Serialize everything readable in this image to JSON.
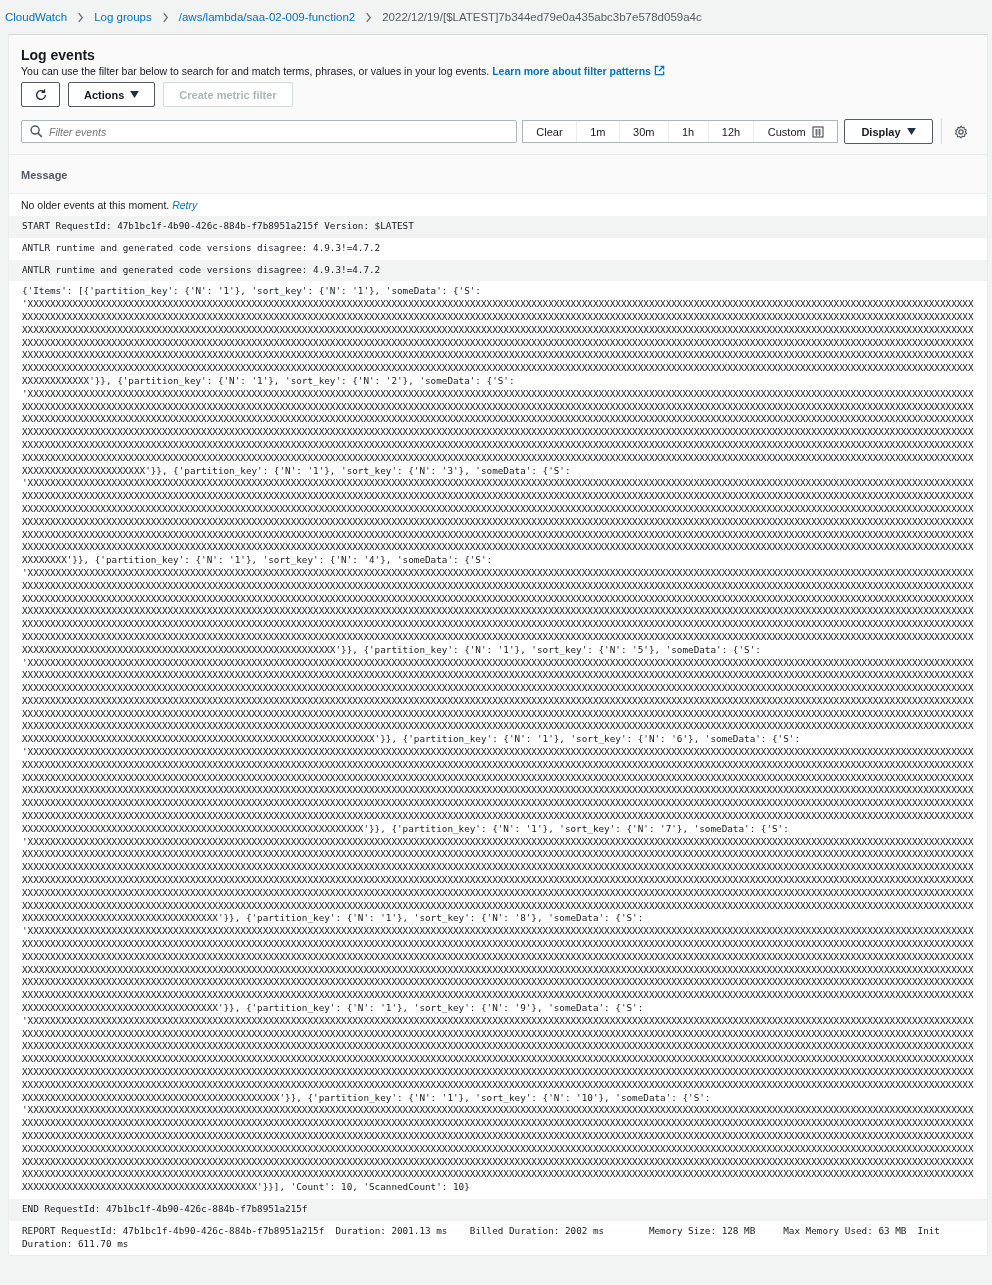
{
  "breadcrumbs": [
    {
      "label": "CloudWatch",
      "link": true
    },
    {
      "label": "Log groups",
      "link": true
    },
    {
      "label": "/aws/lambda/saa-02-009-function2",
      "link": true
    },
    {
      "label": "2022/12/19/[$LATEST]7b344ed79e0a435abc3b7e578d059a4c",
      "link": false
    }
  ],
  "panel": {
    "title": "Log events",
    "description": "You can use the filter bar below to search for and match terms, phrases, or values in your log events.",
    "learn_more": "Learn more about filter patterns"
  },
  "toolbar": {
    "actions": "Actions",
    "create_metric_filter": {
      "label": "Create metric filter",
      "disabled": true
    }
  },
  "filter": {
    "placeholder": "Filter events"
  },
  "time_ranges": [
    {
      "label": "Clear",
      "selected": false
    },
    {
      "label": "1m",
      "selected": false
    },
    {
      "label": "30m",
      "selected": false
    },
    {
      "label": "1h",
      "selected": false
    },
    {
      "label": "12h",
      "selected": false
    },
    {
      "label": "Custom",
      "selected": false
    }
  ],
  "display": "Display",
  "table": {
    "columns": [
      "Message"
    ],
    "rows": [
      {
        "kind": "notice",
        "text": "No older events at this moment.",
        "link": "Retry"
      },
      {
        "kind": "event",
        "text": "START RequestId: 47b1bc1f-4b90-426c-884b-f7b8951a215f Version: $LATEST"
      },
      {
        "kind": "event",
        "text": "ANTLR runtime and generated code versions disagree: 4.9.3!=4.7.2"
      },
      {
        "kind": "event",
        "text": "ANTLR runtime and generated code versions disagree: 4.9.3!=4.7.2"
      },
      {
        "kind": "event",
        "text": "{'Items': [{'partition_key': {'N': '1'}, 'sort_key': {'N': '1'}, 'someData': {'S': 'XXXXXXXXXXXXXXXXXXXXXXXXXXXXXXXXXXXXXXXXXXXXXXXXXXXXXXXXXXXXXXXXXXXXXXXXXXXXXXXXXXXXXXXXXXXXXXXXXXXXXXXXXXXXXXXXXXXXXXXXXXXXXXXXXXXXXXXXXXXXXXXXXXXXXXXXXXXXXXXXXXXXXXXXXXXXXXXXXXXXXXXXXXXXXXXXXXXXXXXXXXXXXXXXXXXXXXXXXXXXXXXXXXXXXXXXXXXXXXXXXXXXXXXXXXXXXXXXXXXXXXXXXXXXXXXXXXXXXXXXXXXXXXXXXXXXXXXXXXXXXXXXXXXXXXXXXXXXXXXXXXXXXXXXXXXXXXXXXXXXXXXXXXXXXXXXXXXXXXXXXXXXXXXXXXXXXXXXXXXXXXXXXXXXXXXXXXXXXXXXXXXXXXXXXXXXXXXXXXXXXXXXXXXXXXXXXXXXXXXXXXXXXXXXXXXXXXXXXXXXXXXXXXXXXXXXXXXXXXXXXXXXXXXXXXXXXXXXXXXXXXXXXXXXXXXXXXXXXXXXXXXXXXXXXXXXXXXXXXXXXXXXXXXXXXXXXXXXXXXXXXXXXXXXXXXXXXXXXXXXXXXXXXXXXXXXXXXXXXXXXXXXXXXXXXXXXXXXXXXXXXXXXXXXXXXXXXXXXXXXXXXXXXXXXXXXXXXXXXXXXXXXXXXXXXXXXXXXXXXXXXXXXXXXXXXXXXXXXXXXXXXXXXXXXXXXXXXXXXXXXXXXXXXXXXXXXXXXXXXXXXXXXXXXXXXXXXXXXXXXXXXXXXXXXXXXXXXXXXXXXXXXXXXXXXXXXXXXXXXXXXXXXXXXXXXXXXXXXXXXXXXXXXXXXXXXXXXXXXXXXXXXXXXXXXXXXXXXXXXXXXXXXXXXXXXXXXXXXXXXXXXXXXXXXXXXXXXXXXXXXXXXXXXXXXXXXXXXXXXXXXXXXXXXXXXXXXXXXXXXXXXXXXXXXXXXXXXXXXXXXXXXXXXXXXXXXXXXXXXXXXXXXXXXXXXXXXXXXXXXXXXXXXXXXXXXXXXXXXXXXXXXXXXXXXX'}}, {'partition_key': {'N': '1'}, 'sort_key': {'N': '2'}, 'someData': {'S': 'XXXXXXXXXXXXXXXXXXXXXXXXXXXXXXXXXXXXXXXXXXXXXXXXXXXXXXXXXXXXXXXXXXXXXXXXXXXXXXXXXXXXXXXXXXXXXXXXXXXXXXXXXXXXXXXXXXXXXXXXXXXXXXXXXXXXXXXXXXXXXXXXXXXXXXXXXXXXXXXXXXXXXXXXXXXXXXXXXXXXXXXXXXXXXXXXXXXXXXXXXXXXXXXXXXXXXXXXXXXXXXXXXXXXXXXXXXXXXXXXXXXXXXXXXXXXXXXXXXXXXXXXXXXXXXXXXXXXXXXXXXXXXXXXXXXXXXXXXXXXXXXXXXXXXXXXXXXXXXXXXXXXXXXXXXXXXXXXXXXXXXXXXXXXXXXXXXXXXXXXXXXXXXXXXXXXXXXXXXXXXXXXXXXXXXXXXXXXXXXXXXXXXXXXXXXXXXXXXXXXXXXXXXXXXXXXXXXXXXXXXXXXXXXXXXXXXXXXXXXXXXXXXXXXXXXXXXXXXXXXXXXXXXXXXXXXXXXXXXXXXXXXXXXXXXXXXXXXXXXXXXXXXXXXXXXXXXXXXXXXXXXXXXXXXXXXXXXXXXXXXXXXXXXXXXXXXXXXXXXXXXXXXXXXXXXXXXXXXXXXXXXXXXXXXXXXXXXXXXXXXXXXXXXXXXXXXXXXXXXXXXXXXXXXXXXXXXXXXXXXXXXXXXXXXXXXXXXXXXXXXXXXXXXXXXXXXXXXXXXXXXXXXXXXXXXXXXXXXXXXXXXXXXXXXXXXXXXXXXXXXXXXXXXXXXXXXXXXXXXXXXXXXXXXXXXXXXXXXXXXXXXXXXXXXXXXXXXXXXXXXXXXXXXXXXXXXXXXXXXXXXXXXXXXXXXXXXXXXXXXXXXXXXXXXXXXXXXXXXXXXXXXXXXXXXXXXXXXXXXXXXXXXXXXXXXXXXXXXXXXXXXXXXXXXXXXXXXXXXXXXXXXXXXXXXXXXXXXXXXXXXXXXXXXXXXXXXXXXXXXXXXXXXXXXXXXXXXXXXXXXXXXXXXXXXXXXXXXXXXXXXXXXXXXXXXXXXXXXXXXXXXXXXXXXXXXXXXXXXXXX'}}, {'partition_key': {'N': '1'}, 'sort_key': {'N': '3'}, 'someData': {'S': 'XXXXXXXXXXXXXXXXXXXXXXXXXXXXXXXXXXXXXXXXXXXXXXXXXXXXXXXXXXXXXXXXXXXXXXXXXXXXXXXXXXXXXXXXXXXXXXXXXXXXXXXXXXXXXXXXXXXXXXXXXXXXXXXXXXXXXXXXXXXXXXXXXXXXXXXXXXXXXXXXXXXXXXXXXXXXXXXXXXXXXXXXXXXXXXXXXXXXXXXXXXXXXXXXXXXXXXXXXXXXXXXXXXXXXXXXXXXXXXXXXXXXXXXXXXXXXXXXXXXXXXXXXXXXXXXXXXXXXXXXXXXXXXXXXXXXXXXXXXXXXXXXXXXXXXXXXXXXXXXXXXXXXXXXXXXXXXXXXXXXXXXXXXXXXXXXXXXXXXXXXXXXXXXXXXXXXXXXXXXXXXXXXXXXXXXXXXXXXXXXXXXXXXXXXXXXXXXXXXXXXXXXXXXXXXXXXXXXXXXXXXXXXXXXXXXXXXXXXXXXXXXXXXXXXXXXXXXXXXXXXXXXXXXXXXXXXXXXXXXXXXXXXXXXXXXXXXXXXXXXXXXXXXXXXXXXXXXXXXXXXXXXXXXXXXXXXXXXXXXXXXXXXXXXXXXXXXXXXXXXXXXXXXXXXXXXXXXXXXXXXXXXXXXXXXXXXXXXXXXXXXXXXXXXXXXXXXXXXXXXXXXXXXXXXXXXXXXXXXXXXXXXXXXXXXXXXXXXXXXXXXXXXXXXXXXXXXXXXXXXXXXXXXXXXXXXXXXXXXXXXXXXXXXXXXXXXXXXXXXXXXXXXXXXXXXXXXXXXXXXXXXXXXXXXXXXXXXXXXXXXXXXXXXXXXXXXXXXXXXXXXXXXXXXXXXXXXXXXXXXXXXXXXXXXXXXXXXXXXXXXXXXXXXXXXXXXXXXXXXXXXXXXXXXXXXXXXXXXXXXXXXXXXXXXXXXXXXXXXXXXXXXXXXXXXXXXXXXXXXXXXXXXXXXXXXXXXXXXXXXXXXXXXXXXXXXXXXXXXXXXXXXXXXXXXXXXXXXXXXXXXXXXXXXXXXXXXXXXXXXXXXXXXXXXXXXXXXXXXXXXXXXXXX'}}, {'partition_key': {'N': '1'}, 'sort_key': {'N': '4'}, 'someData': {'S': 'XXXXXXXXXXXXXXXXXXXXXXXXXXXXXXXXXXXXXXXXXXXXXXXXXXXXXXXXXXXXXXXXXXXXXXXXXXXXXXXXXXXXXXXXXXXXXXXXXXXXXXXXXXXXXXXXXXXXXXXXXXXXXXXXXXXXXXXXXXXXXXXXXXXXXXXXXXXXXXXXXXXXXXXXXXXXXXXXXXXXXXXXXXXXXXXXXXXXXXXXXXXXXXXXXXXXXXXXXXXXXXXXXXXXXXXXXXXXXXXXXXXXXXXXXXXXXXXXXXXXXXXXXXXXXXXXXXXXXXXXXXXXXXXXXXXXXXXXXXXXXXXXXXXXXXXXXXXXXXXXXXXXXXXXXXXXXXXXXXXXXXXXXXXXXXXXXXXXXXXXXXXXXXXXXXXXXXXXXXXXXXXXXXXXXXXXXXXXXXXXXXXXXXXXXXXXXXXXXXXXXXXXXXXXXXXXXXXXXXXXXXXXXXXXXXXXXXXXXXXXXXXXXXXXXXXXXXXXXXXXXXXXXXXXXXXXXXXXXXXXXXXXXXXXXXXXXXXXXXXXXXXXXXXXXXXXXXXXXXXXXXXXXXXXXXXXXXXXXXXXXXXXXXXXXXXXXXXXXXXXXXXXXXXXXXXXXXXXXXXXXXXXXXXXXXXXXXXXXXXXXXXXXXXXXXXXXXXXXXXXXXXXXXXXXXXXXXXXXXXXXXXXXXXXXXXXXXXXXXXXXXXXXXXXXXXXXXXXXXXXXXXXXXXXXXXXXXXXXXXXXXXXXXXXXXXXXXXXXXXXXXXXXXXXXXXXXXXXXXXXXXXXXXXXXXXXXXXXXXXXXXXXXXXXXXXXXXXXXXXXXXXXXXXXXXXXXXXXXXXXXXXXXXXXXXXXXXXXXXXXXXXXXXXXXXXXXXXXXXXXXXXXXXXXXXXXXXXXXXXXXXXXXXXXXXXXXXXXXXXXXXXXXXXXXXXXXXXXXXXXXXXXXXXXXXXXXXXXXXXXXXXXXXXXXXXXXXXXXXXXXXXXXXXXXXXXXXXXXXXXXXXXXXXXXXXXXXXXXXXXXXXXXXXXXXXXXXXXXXXXXXXXXXXXXXXXXXXXXXXXXXXXXXXXXXXXXXXXXXXXXXXXXXXXXXXXXXX'}}, {'partition_key': {'N': '1'}, 'sort_key': {'N': '5'}, 'someData': {'S': 'XXXXXXXXXXXXXXXXXXXXXXXXXXXXXXXXXXXXXXXXXXXXXXXXXXXXXXXXXXXXXXXXXXXXXXXXXXXXXXXXXXXXXXXXXXXXXXXXXXXXXXXXXXXXXXXXXXXXXXXXXXXXXXXXXXXXXXXXXXXXXXXXXXXXXXXXXXXXXXXXXXXXXXXXXXXXXXXXXXXXXXXXXXXXXXXXXXXXXXXXXXXXXXXXXXXXXXXXXXXXXXXXXXXXXXXXXXXXXXXXXXXXXXXXXXXXXXXXXXXXXXXXXXXXXXXXXXXXXXXXXXXXXXXXXXXXXXXXXXXXXXXXXXXXXXXXXXXXXXXXXXXXXXXXXXXXXXXXXXXXXXXXXXXXXXXXXXXXXXXXXXXXXXXXXXXXXXXXXXXXXXXXXXXXXXXXXXXXXXXXXXXXXXXXXXXXXXXXXXXXXXXXXXXXXXXXXXXXXXXXXXXXXXXXXXXXXXXXXXXXXXXXXXXXXXXXXXXXXXXXXXXXXXXXXXXXXXXXXXXXXXXXXXXXXXXXXXXXXXXXXXXXXXXXXXXXXXXXXXXXXXXXXXXXXXXXXXXXXXXXXXXXXXXXXXXXXXXXXXXXXXXXXXXXXXXXXXXXXXXXXXXXXXXXXXXXXXXXXXXXXXXXXXXXXXXXXXXXXXXXXXXXXXXXXXXXXXXXXXXXXXXXXXXXXXXXXXXXXXXXXXXXXXXXXXXXXXXXXXXXXXXXXXXXXXXXXXXXXXXXXXXXXXXXXXXXXXXXXXXXXXXXXXXXXXXXXXXXXXXXXXXXXXXXXXXXXXXXXXXXXXXXXXXXXXXXXXXXXXXXXXXXXXXXXXXXXXXXXXXXXXXXXXXXXXXXXXXXXXXXXXXXXXXXXXXXXXXXXXXXXXXXXXXXXXXXXXXXXXXXXXXXXXXXXXXXXXXXXXXXXXXXXXXXXXXXXXXXXXXXXXXXXXXXXXXXXXXXXXXXXXXXXXXXXXXXXXXXXXXXXXXXXXXXXXXXXXXXXXXXXXXXXXXXXXXXXXXXXXXXXXXXXXXXXXXXXXXXXXXXXXXXXXXXXXXXXXXXXXXXXXXXXXXXXXXXXXXXXXXXXXXXXXXXXXXXXXXXXXXXXX'}}, {'partition_key': {'N': '1'}, 'sort_key': {'N': '6'}, 'someData': {'S': 'XXXXXXXXXXXXXXXXXXXXXXXXXXXXXXXXXXXXXXXXXXXXXXXXXXXXXXXXXXXXXXXXXXXXXXXXXXXXXXXXXXXXXXXXXXXXXXXXXXXXXXXXXXXXXXXXXXXXXXXXXXXXXXXXXXXXXXXXXXXXXXXXXXXXXXXXXXXXXXXXXXXXXXXXXXXXXXXXXXXXXXXXXXXXXXXXXXXXXXXXXXXXXXXXXXXXXXXXXXXXXXXXXXXXXXXXXXXXXXXXXXXXXXXXXXXXXXXXXXXXXXXXXXXXXXXXXXXXXXXXXXXXXXXXXXXXXXXXXXXXXXXXXXXXXXXXXXXXXXXXXXXXXXXXXXXXXXXXXXXXXXXXXXXXXXXXXXXXXXXXXXXXXXXXXXXXXXXXXXXXXXXXXXXXXXXXXXXXXXXXXXXXXXXXXXXXXXXXXXXXXXXXXXXXXXXXXXXXXXXXXXXXXXXXXXXXXXXXXXXXXXXXXXXXXXXXXXXXXXXXXXXXXXXXXXXXXXXXXXXXXXXXXXXXXXXXXXXXXXXXXXXXXXXXXXXXXXXXXXXXXXXXXXXXXXXXXXXXXXXXXXXXXXXXXXXXXXXXXXXXXXXXXXXXXXXXXXXXXXXXXXXXXXXXXXXXXXXXXXXXXXXXXXXXXXXXXXXXXXXXXXXXXXXXXXXXXXXXXXXXXXXXXXXXXXXXXXXXXXXXXXXXXXXXXXXXXXXXXXXXXXXXXXXXXXXXXXXXXXXXXXXXXXXXXXXXXXXXXXXXXXXXXXXXXXXXXXXXXXXXXXXXXXXXXXXXXXXXXXXXXXXXXXXXXXXXXXXXXXXXXXXXXXXXXXXXXXXXXXXXXXXXXXXXXXXXXXXXXXXXXXXXXXXXXXXXXXXXXXXXXXXXXXXXXXXXXXXXXXXXXXXXXXXXXXXXXXXXXXXXXXXXXXXXXXXXXXXXXXXXXXXXXXXXXXXXXXXXXXXXXXXXXXXXXXXXXXXXXXXXXXXXXXXXXXXXXXXXXXXXXXXXXXXXXXXXXXXXXXXXXXXXXXXXXXXXXXXXXXXXXXXXXXXXXXXXXXXXXXXXXXXXXXXXXXXXXXXXXXXXXXXXXXXXXXXXXXXXXXXX'}}, {'partition_key': {'N': '1'}, 'sort_key': {'N': '7'}, 'someData': {'S': 'XXXXXXXXXXXXXXXXXXXXXXXXXXXXXXXXXXXXXXXXXXXXXXXXXXXXXXXXXXXXXXXXXXXXXXXXXXXXXXXXXXXXXXXXXXXXXXXXXXXXXXXXXXXXXXXXXXXXXXXXXXXXXXXXXXXXXXXXXXXXXXXXXXXXXXXXXXXXXXXXXXXXXXXXXXXXXXXXXXXXXXXXXXXXXXXXXXXXXXXXXXXXXXXXXXXXXXXXXXXXXXXXXXXXXXXXXXXXXXXXXXXXXXXXXXXXXXXXXXXXXXXXXXXXXXXXXXXXXXXXXXXXXXXXXXXXXXXXXXXXXXXXXXXXXXXXXXXXXXXXXXXXXXXXXXXXXXXXXXXXXXXXXXXXXXXXXXXXXXXXXXXXXXXXXXXXXXXXXXXXXXXXXXXXXXXXXXXXXXXXXXXXXXXXXXXXXXXXXXXXXXXXXXXXXXXXXXXXXXXXXXXXXXXXXXXXXXXXXXXXXXXXXXXXXXXXXXXXXXXXXXXXXXXXXXXXXXXXXXXXXXXXXXXXXXXXXXXXXXXXXXXXXXXXXXXXXXXXXXXXXXXXXXXXXXXXXXXXXXXXXXXXXXXXXXXXXXXXXXXXXXXXXXXXXXXXXXXXXXXXXXXXXXXXXXXXXXXXXXXXXXXXXXXXXXXXXXXXXXXXXXXXXXXXXXXXXXXXXXXXXXXXXXXXXXXXXXXXXXXXXXXXXXXXXXXXXXXXXXXXXXXXXXXXXXXXXXXXXXXXXXXXXXXXXXXXXXXXXXXXXXXXXXXXXXXXXXXXXXXXXXXXXXXXXXXXXXXXXXXXXXXXXXXXXXXXXXXXXXXXXXXXXXXXXXXXXXXXXXXXXXXXXXXXXXXXXXXXXXXXXXXXXXXXXXXXXXXXXXXXXXXXXXXXXXXXXXXXXXXXXXXXXXXXXXXXXXXXXXXXXXXXXXXXXXXXXXXXXXXXXXXXXXXXXXXXXXXXXXXXXXXXXXXXXXXXXXXXXXXXXXXXXXXXXXXXXXXXXXXXXXXXXXXXXXXXXXXXXXXXXXXXXXXXXXXXXXXXXXXXXXXXXXXXXXXXXXXXXXXXXXXXXXXXXXXXXX'}}, {'partition_key': {'N': '1'}, 'sort_key': {'N': '8'}, 'someData': {'S': 'XXXXXXXXXXXXXXXXXXXXXXXXXXXXXXXXXXXXXXXXXXXXXXXXXXXXXXXXXXXXXXXXXXXXXXXXXXXXXXXXXXXXXXXXXXXXXXXXXXXXXXXXXXXXXXXXXXXXXXXXXXXXXXXXXXXXXXXXXXXXXXXXXXXXXXXXXXXXXXXXXXXXXXXXXXXXXXXXXXXXXXXXXXXXXXXXXXXXXXXXXXXXXXXXXXXXXXXXXXXXXXXXXXXXXXXXXXXXXXXXXXXXXXXXXXXXXXXXXXXXXXXXXXXXXXXXXXXXXXXXXXXXXXXXXXXXXXXXXXXXXXXXXXXXXXXXXXXXXXXXXXXXXXXXXXXXXXXXXXXXXXXXXXXXXXXXXXXXXXXXXXXXXXXXXXXXXXXXXXXXXXXXXXXXXXXXXXXXXXXXXXXXXXXXXXXXXXXXXXXXXXXXXXXXXXXXXXXXXXXXXXXXXXXXXXXXXXXXXXXXXXXXXXXXXXXXXXXXXXXXXXXXXXXXXXXXXXXXXXXXXXXXXXXXXXXXXXXXXXXXXXXXXXXXXXXXXXXXXXXXXXXXXXXXXXXXXXXXXXXXXXXXXXXXXXXXXXXXXXXXXXXXXXXXXXXXXXXXXXXXXXXXXXXXXXXXXXXXXXXXXXXXXXXXXXXXXXXXXXXXXXXXXXXXXXXXXXXXXXXXXXXXXXXXXXXXXXXXXXXXXXXXXXXXXXXXXXXXXXXXXXXXXXXXXXXXXXXXXXXXXXXXXXXXXXXXXXXXXXXXXXXXXXXXXXXXXXXXXXXXXXXXXXXXXXXXXXXXXXXXXXXXXXXXXXXXXXXXXXXXXXXXXXXXXXXXXXXXXXXXXXXXXXXXXXXXXXXXXXXXXXXXXXXXXXXXXXXXXXXXXXXXXXXXXXXXXXXXXXXXXXXXXXXXXXXXXXXXXXXXXXXXXXXXXXXXXXXXXXXXXXXXXXXXXXXXXXXXXXXXXXXXXXXXXXXXXXXXXXXXXXXXXXXXXXXXXXXXXXXXXXXXXXXXXXXXXXXXXXXXXXXXXXXXXXXXXXXXXXXXXXXXXXXXXXXXXXXXXXXXXXXXXXXXXXXXXX'}}, {'partition_key': {'N': '1'}, 'sort_key': {'N': '9'}, 'someData': {'S': 'XXXXXXXXXXXXXXXXXXXXXXXXXXXXXXXXXXXXXXXXXXXXXXXXXXXXXXXXXXXXXXXXXXXXXXXXXXXXXXXXXXXXXXXXXXXXXXXXXXXXXXXXXXXXXXXXXXXXXXXXXXXXXXXXXXXXXXXXXXXXXXXXXXXXXXXXXXXXXXXXXXXXXXXXXXXXXXXXXXXXXXXXXXXXXXXXXXXXXXXXXXXXXXXXXXXXXXXXXXXXXXXXXXXXXXXXXXXXXXXXXXXXXXXXXXXXXXXXXXXXXXXXXXXXXXXXXXXXXXXXXXXXXXXXXXXXXXXXXXXXXXXXXXXXXXXXXXXXXXXXXXXXXXXXXXXXXXXXXXXXXXXXXXXXXXXXXXXXXXXXXXXXXXXXXXXXXXXXXXXXXXXXXXXXXXXXXXXXXXXXXXXXXXXXXXXXXXXXXXXXXXXXXXXXXXXXXXXXXXXXXXXXXXXXXXXXXXXXXXXXXXXXXXXXXXXXXXXXXXXXXXXXXXXXXXXXXXXXXXXXXXXXXXXXXXXXXXXXXXXXXXXXXXXXXXXXXXXXXXXXXXXXXXXXXXXXXXXXXXXXXXXXXXXXXXXXXXXXXXXXXXXXXXXXXXXXXXXXXXXXXXXXXXXXXXXXXXXXXXXXXXXXXXXXXXXXXXXXXXXXXXXXXXXXXXXXXXXXXXXXXXXXXXXXXXXXXXXXXXXXXXXXXXXXXXXXXXXXXXXXXXXXXXXXXXXXXXXXXXXXXXXXXXXXXXXXXXXXXXXXXXXXXXXXXXXXXXXXXXXXXXXXXXXXXXXXXXXXXXXXXXXXXXXXXXXXXXXXXXXXXXXXXXXXXXXXXXXXXXXXXXXXXXXXXXXXXXXXXXXXXXXXXXXXXXXXXXXXXXXXXXXXXXXXXXXXXXXXXXXXXXXXXXXXXXXXXXXXXXXXXXXXXXXXXXXXXXXXXXXXXXXXXXXXXXXXXXXXXXXXXXXXXXXXXXXXXXXXXXXXXXXXXXXXXXXXXXXXXXXXXXXXXXXXXXXXXXXXXXXXXXXXXXXXXXXXXXXXXXXXXXXXXXXXXXXXXXXXXXXXXXXXXXXXXXXXXXXXXXXXXXXXX'}}, {'partition_key': {'N': '1'}, 'sort_key': {'N': '10'}, 'someData': {'S': 'XXXXXXXXXXXXXXXXXXXXXXXXXXXXXXXXXXXXXXXXXXXXXXXXXXXXXXXXXXXXXXXXXXXXXXXXXXXXXXXXXXXXXXXXXXXXXXXXXXXXXXXXXXXXXXXXXXXXXXXXXXXXXXXXXXXXXXXXXXXXXXXXXXXXXXXXXXXXXXXXXXXXXXXXXXXXXXXXXXXXXXXXXXXXXXXXXXXXXXXXXXXXXXXXXXXXXXXXXXXXXXXXXXXXXXXXXXXXXXXXXXXXXXXXXXXXXXXXXXXXXXXXXXXXXXXXXXXXXXXXXXXXXXXXXXXXXXXXXXXXXXXXXXXXXXXXXXXXXXXXXXXXXXXXXXXXXXXXXXXXXXXXXXXXXXXXXXXXXXXXXXXXXXXXXXXXXXXXXXXXXXXXXXXXXXXXXXXXXXXXXXXXXXXXXXXXXXXXXXXXXXXXXXXXXXXXXXXXXXXXXXXXXXXXXXXXXXXXXXXXXXXXXXXXXXXXXXXXXXXXXXXXXXXXXXXXXXXXXXXXXXXXXXXXXXXXXXXXXXXXXXXXXXXXXXXXXXXXXXXXXXXXXXXXXXXXXXXXXXXXXXXXXXXXXXXXXXXXXXXXXXXXXXXXXXXXXXXXXXXXXXXXXXXXXXXXXXXXXXXXXXXXXXXXXXXXXXXXXXXXXXXXXXXXXXXXXXXXXXXXXXXXXXXXXXXXXXXXXXXXXXXXXXXXXXXXXXXXXXXXXXXXXXXXXXXXXXXXXXXXXXXXXXXXXXXXXXXXXXXXXXXXXXXXXXXXXXXXXXXXXXXXXXXXXXXXXXXXXXXXXXXXXXXXXXXXXXXXXXXXXXXXXXXXXXXXXXXXXXXXXXXXXXXXXXXXXXXXXXXXXXXXXXXXXXXXXXXXXXXXXXXXXXXXXXXXXXXXXXXXXXXXXXXXXXXXXXXXXXXXXXXXXXXXXXXXXXXXXXXXXXXXXXXXXXXXXXXXXXXXXXXXXXXXXXXXXXXXXXXXXXXXXXXXXXXXXXXXXXXXXXXXXXXXXXXXXXXXXXXXXXXXXXXXXXXXXXXXXXXXXXXXXXXXXXXXXXXXXXXXXXXXXXXXXXXXXXXXXXXXX'}}], 'Count': 10, 'ScannedCount': 10}"
      },
      {
        "kind": "event",
        "text": "END RequestId: 47b1bc1f-4b90-426c-884b-f7b8951a215f"
      },
      {
        "kind": "event",
        "text": "REPORT RequestId: 47b1bc1f-4b90-426c-884b-f7b8951a215f\tDuration: 2001.13 ms\tBilled Duration: 2002 ms\tMemory Size: 128 MB\tMax Memory Used: 63 MB\tInit Duration: 611.70 ms"
      }
    ]
  }
}
